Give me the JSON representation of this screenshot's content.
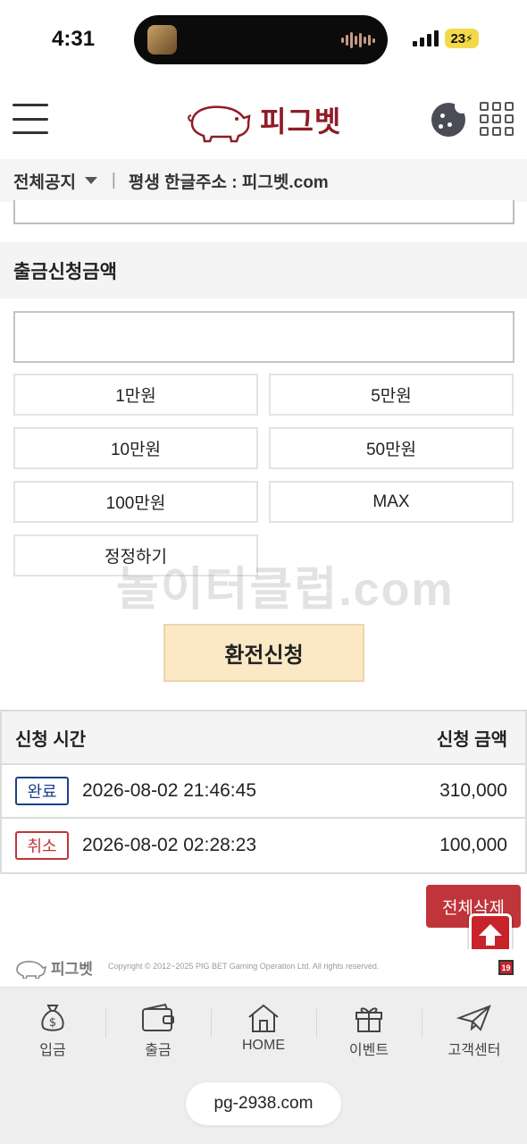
{
  "status_bar": {
    "time": "4:31",
    "battery": "23"
  },
  "header": {
    "logo_text": "피그벳"
  },
  "notice": {
    "label": "전체공지",
    "separator": "|",
    "text": "평생 한글주소 : 피그벳.com"
  },
  "withdraw": {
    "section_label": "출금신청금액",
    "amount_value": "",
    "buttons": [
      "1만원",
      "5만원",
      "10만원",
      "50만원",
      "100만원",
      "MAX",
      "정정하기"
    ],
    "submit_label": "환전신청"
  },
  "watermark": "놀이터클럽.com",
  "history": {
    "col_time": "신청 시간",
    "col_amount": "신청 금액",
    "rows": [
      {
        "status": "완료",
        "status_color": "#1d3f8a",
        "time": "2026-08-02 21:46:45",
        "amount": "310,000"
      },
      {
        "status": "취소",
        "status_color": "#c0353a",
        "time": "2026-08-02 02:28:23",
        "amount": "100,000"
      }
    ]
  },
  "delete_all_label": "전체삭제",
  "footer": {
    "logo_text": "피그벳",
    "copyright": "Copyright © 2012~2025 PIG BET Gaming Operation Ltd. All rights reserved.",
    "age_badge": "19"
  },
  "bottom_nav": [
    {
      "label": "입금",
      "icon": "money-bag-icon"
    },
    {
      "label": "출금",
      "icon": "wallet-icon"
    },
    {
      "label": "HOME",
      "icon": "home-icon"
    },
    {
      "label": "이벤트",
      "icon": "gift-icon"
    },
    {
      "label": "고객센터",
      "icon": "paper-plane-icon"
    }
  ],
  "browser": {
    "url": "pg-2938.com"
  },
  "colors": {
    "brand": "#8e1d26",
    "accent_red": "#c0353a",
    "submit_bg": "#fbe8c5"
  }
}
